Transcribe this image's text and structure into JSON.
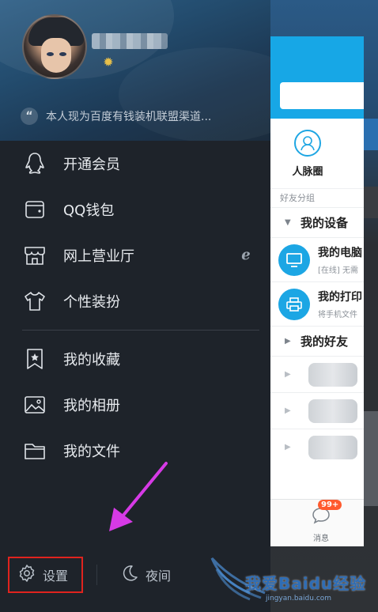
{
  "drawer": {
    "profile": {
      "signature": "本人现为百度有钱装机联盟渠道..."
    },
    "menu": [
      {
        "label": "开通会员",
        "icon": "penguin-icon"
      },
      {
        "label": "QQ钱包",
        "icon": "wallet-icon"
      },
      {
        "label": "网上营业厅",
        "icon": "store-icon",
        "trailing_icon": "telecom-icon"
      },
      {
        "label": "个性装扮",
        "icon": "tshirt-icon"
      },
      {
        "label": "我的收藏",
        "icon": "bookmark-star-icon"
      },
      {
        "label": "我的相册",
        "icon": "image-icon"
      },
      {
        "label": "我的文件",
        "icon": "folder-icon"
      }
    ],
    "bottom": {
      "settings_label": "设置",
      "night_label": "夜间"
    }
  },
  "panel": {
    "people_circle_label": "人脉圈",
    "group_title": "好友分组",
    "groups": {
      "devices_label": "我的设备",
      "friends_label": "我的好友"
    },
    "devices": [
      {
        "name": "我的电脑",
        "sub": "[在线] 无需",
        "icon": "monitor-icon"
      },
      {
        "name": "我的打印",
        "sub": "将手机文件",
        "icon": "printer-icon"
      }
    ],
    "tabbar": {
      "message_label": "消息",
      "badge": "99+"
    }
  },
  "watermark": {
    "text": "我爱Baidu经验",
    "url": "jingyan.baidu.com"
  },
  "colors": {
    "drawer_bg": "#1e232a",
    "accent_blue": "#17a7e6",
    "highlight_red": "#e0231e",
    "annotation_magenta": "#d63ae6"
  }
}
